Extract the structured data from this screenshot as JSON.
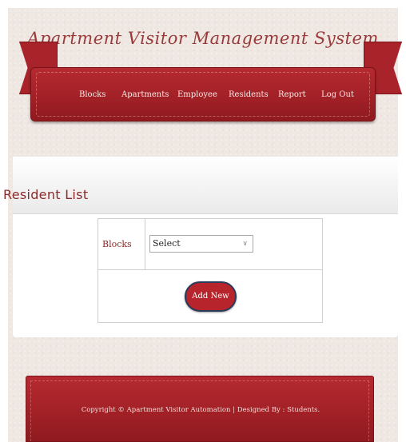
{
  "header": {
    "title": "Apartment Visitor Management System"
  },
  "nav": {
    "items": [
      {
        "label": "Blocks"
      },
      {
        "label": "Apartments"
      },
      {
        "label": "Employee"
      },
      {
        "label": "Residents"
      },
      {
        "label": "Report"
      },
      {
        "label": "Log Out"
      }
    ]
  },
  "main": {
    "title": "Resident List",
    "form": {
      "blocks_label": "Blocks",
      "blocks_select_value": "Select",
      "add_button_label": "Add New"
    }
  },
  "footer": {
    "text": "Copyright © Apartment Visitor Automation | Designed By : Students."
  },
  "colors": {
    "brand_red": "#a8242a",
    "title_text": "#9a3a3a",
    "page_background": "#efe8e2"
  }
}
